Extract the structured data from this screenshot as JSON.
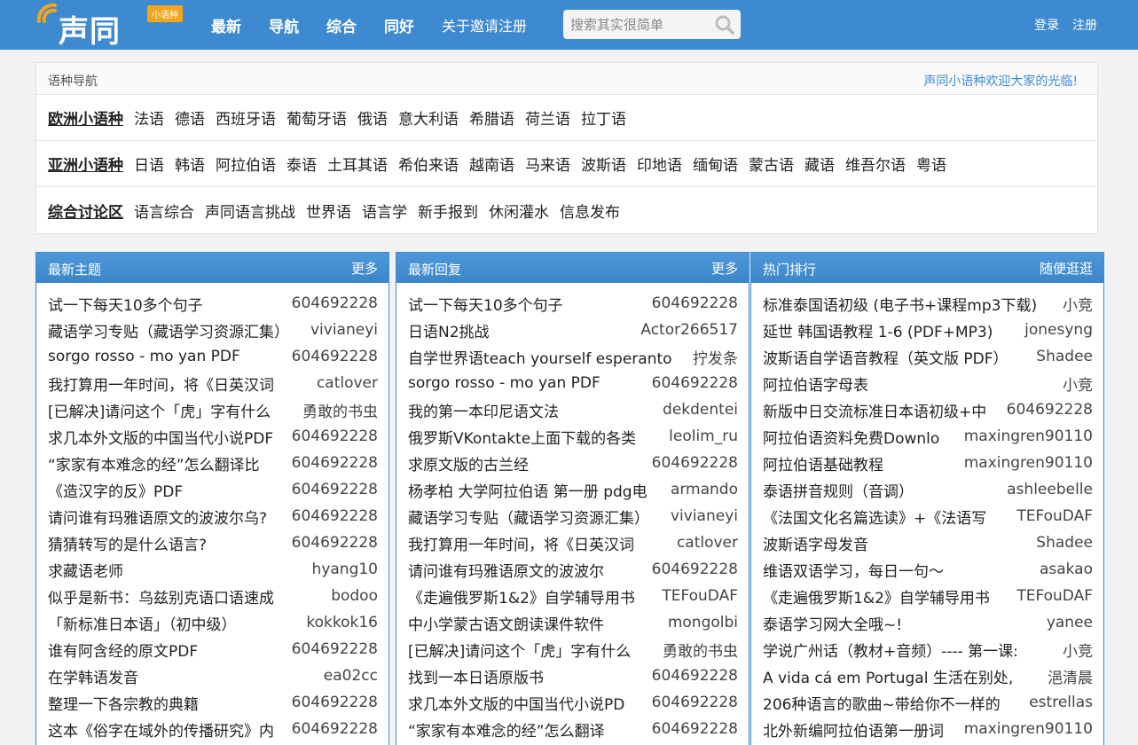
{
  "header": {
    "logo_text": "声同",
    "logo_badge": "小语种",
    "nav": [
      "最新",
      "导航",
      "综合",
      "同好",
      "关于邀请注册"
    ],
    "search_placeholder": "搜索其实很简单",
    "login": "登录",
    "register": "注册"
  },
  "langnav": {
    "title": "语种导航",
    "welcome": "声同小语种欢迎大家的光临!",
    "rows": [
      {
        "category": "欧洲小语种",
        "items": [
          "法语",
          "德语",
          "西班牙语",
          "葡萄牙语",
          "俄语",
          "意大利语",
          "希腊语",
          "荷兰语",
          "拉丁语"
        ]
      },
      {
        "category": "亚洲小语种",
        "items": [
          "日语",
          "韩语",
          "阿拉伯语",
          "泰语",
          "土耳其语",
          "希伯来语",
          "越南语",
          "马来语",
          "波斯语",
          "印地语",
          "缅甸语",
          "蒙古语",
          "藏语",
          "维吾尔语",
          "粤语"
        ]
      },
      {
        "category": "综合讨论区",
        "items": [
          "语言综合",
          "声同语言挑战",
          "世界语",
          "语言学",
          "新手报到",
          "休闲灌水",
          "信息发布"
        ]
      }
    ]
  },
  "panels": [
    {
      "title": "最新主题",
      "more": "更多",
      "rows": [
        {
          "title": "试一下每天10多个句子",
          "author": "604692228"
        },
        {
          "title": "藏语学习专贴（藏语学习资源汇集）",
          "author": "vivianeyi"
        },
        {
          "title": "sorgo rosso - mo yan PDF",
          "author": "604692228"
        },
        {
          "title": "我打算用一年时间，将《日英汉词",
          "author": "catlover"
        },
        {
          "title": "[已解决]请问这个「虎」字有什么",
          "author": "勇敢的书虫"
        },
        {
          "title": "求几本外文版的中国当代小说PDF",
          "author": "604692228"
        },
        {
          "title": "“家家有本难念的经”怎么翻译比",
          "author": "604692228"
        },
        {
          "title": "《造汉字的反》PDF",
          "author": "604692228"
        },
        {
          "title": "请问谁有玛雅语原文的波波尔乌?",
          "author": "604692228"
        },
        {
          "title": "猜猜转写的是什么语言?",
          "author": "604692228"
        },
        {
          "title": "求藏语老师",
          "author": "hyang10"
        },
        {
          "title": "似乎是新书：乌兹别克语口语速成",
          "author": "bodoo"
        },
        {
          "title": "「新标准日本语」（初中级）",
          "author": "kokkok16"
        },
        {
          "title": "谁有阿含经的原文PDF",
          "author": "604692228"
        },
        {
          "title": "在学韩语发音",
          "author": "ea02cc"
        },
        {
          "title": "整理一下各宗教的典籍",
          "author": "604692228"
        },
        {
          "title": "这本《俗字在域外的传播研究》内",
          "author": "604692228"
        }
      ]
    },
    {
      "title": "最新回复",
      "more": "更多",
      "rows": [
        {
          "title": "试一下每天10多个句子",
          "author": "604692228"
        },
        {
          "title": "日语N2挑战",
          "author": "Actor266517"
        },
        {
          "title": "自学世界语teach yourself esperanto",
          "author": "拧发条"
        },
        {
          "title": "sorgo rosso - mo yan PDF",
          "author": "604692228"
        },
        {
          "title": "我的第一本印尼语文法",
          "author": "dekdentei"
        },
        {
          "title": "俄罗斯VKontakte上面下载的各类",
          "author": "leolim_ru"
        },
        {
          "title": "求原文版的古兰经",
          "author": "604692228"
        },
        {
          "title": "杨孝柏 大学阿拉伯语 第一册 pdg电",
          "author": "armando"
        },
        {
          "title": "藏语学习专贴（藏语学习资源汇集）",
          "author": "vivianeyi"
        },
        {
          "title": "我打算用一年时间，将《日英汉词",
          "author": "catlover"
        },
        {
          "title": "请问谁有玛雅语原文的波波尔",
          "author": "604692228"
        },
        {
          "title": "《走遍俄罗斯1&2》自学辅导用书",
          "author": "TEFouDAF"
        },
        {
          "title": "中小学蒙古语文朗读课件软件",
          "author": "mongolbi"
        },
        {
          "title": "[已解决]请问这个「虎」字有什么",
          "author": "勇敢的书虫"
        },
        {
          "title": "找到一本日语原版书",
          "author": "604692228"
        },
        {
          "title": "求几本外文版的中国当代小说PD",
          "author": "604692228"
        },
        {
          "title": "“家家有本难念的经”怎么翻译",
          "author": "604692228"
        }
      ]
    },
    {
      "title": "热门排行",
      "more": "随便逛逛",
      "rows": [
        {
          "title": "标准泰国语初级 (电子书+课程mp3下载)",
          "author": "小竞"
        },
        {
          "title": "延世 韩国语教程 1-6 (PDF+MP3)",
          "author": "jonesyng"
        },
        {
          "title": "波斯语自学语音教程（英文版 PDF）",
          "author": "Shadee"
        },
        {
          "title": "阿拉伯语字母表",
          "author": "小竞"
        },
        {
          "title": "新版中日交流标准日本语初级+中",
          "author": "604692228"
        },
        {
          "title": "阿拉伯语资料免费Downlo",
          "author": "maxingren90110"
        },
        {
          "title": "阿拉伯语基础教程",
          "author": "maxingren90110"
        },
        {
          "title": "泰语拼音规则（音调）",
          "author": "ashleebelle"
        },
        {
          "title": "《法国文化名篇选读》+《法语写",
          "author": "TEFouDAF"
        },
        {
          "title": "波斯语字母发音",
          "author": "Shadee"
        },
        {
          "title": "维语双语学习，每日一句～",
          "author": "asakao"
        },
        {
          "title": "《走遍俄罗斯1&2》自学辅导用书",
          "author": "TEFouDAF"
        },
        {
          "title": "泰语学习网大全哦~!",
          "author": "yanee"
        },
        {
          "title": "学说广州话（教材+音频）---- 第一课:",
          "author": "小竞"
        },
        {
          "title": "A vida cá em Portugal 生活在别处,",
          "author": "浥清晨"
        },
        {
          "title": "206种语言的歌曲~带给你不一样的",
          "author": "estrellas"
        },
        {
          "title": "北外新编阿拉伯语第一册词",
          "author": "maxingren90110"
        }
      ]
    }
  ]
}
